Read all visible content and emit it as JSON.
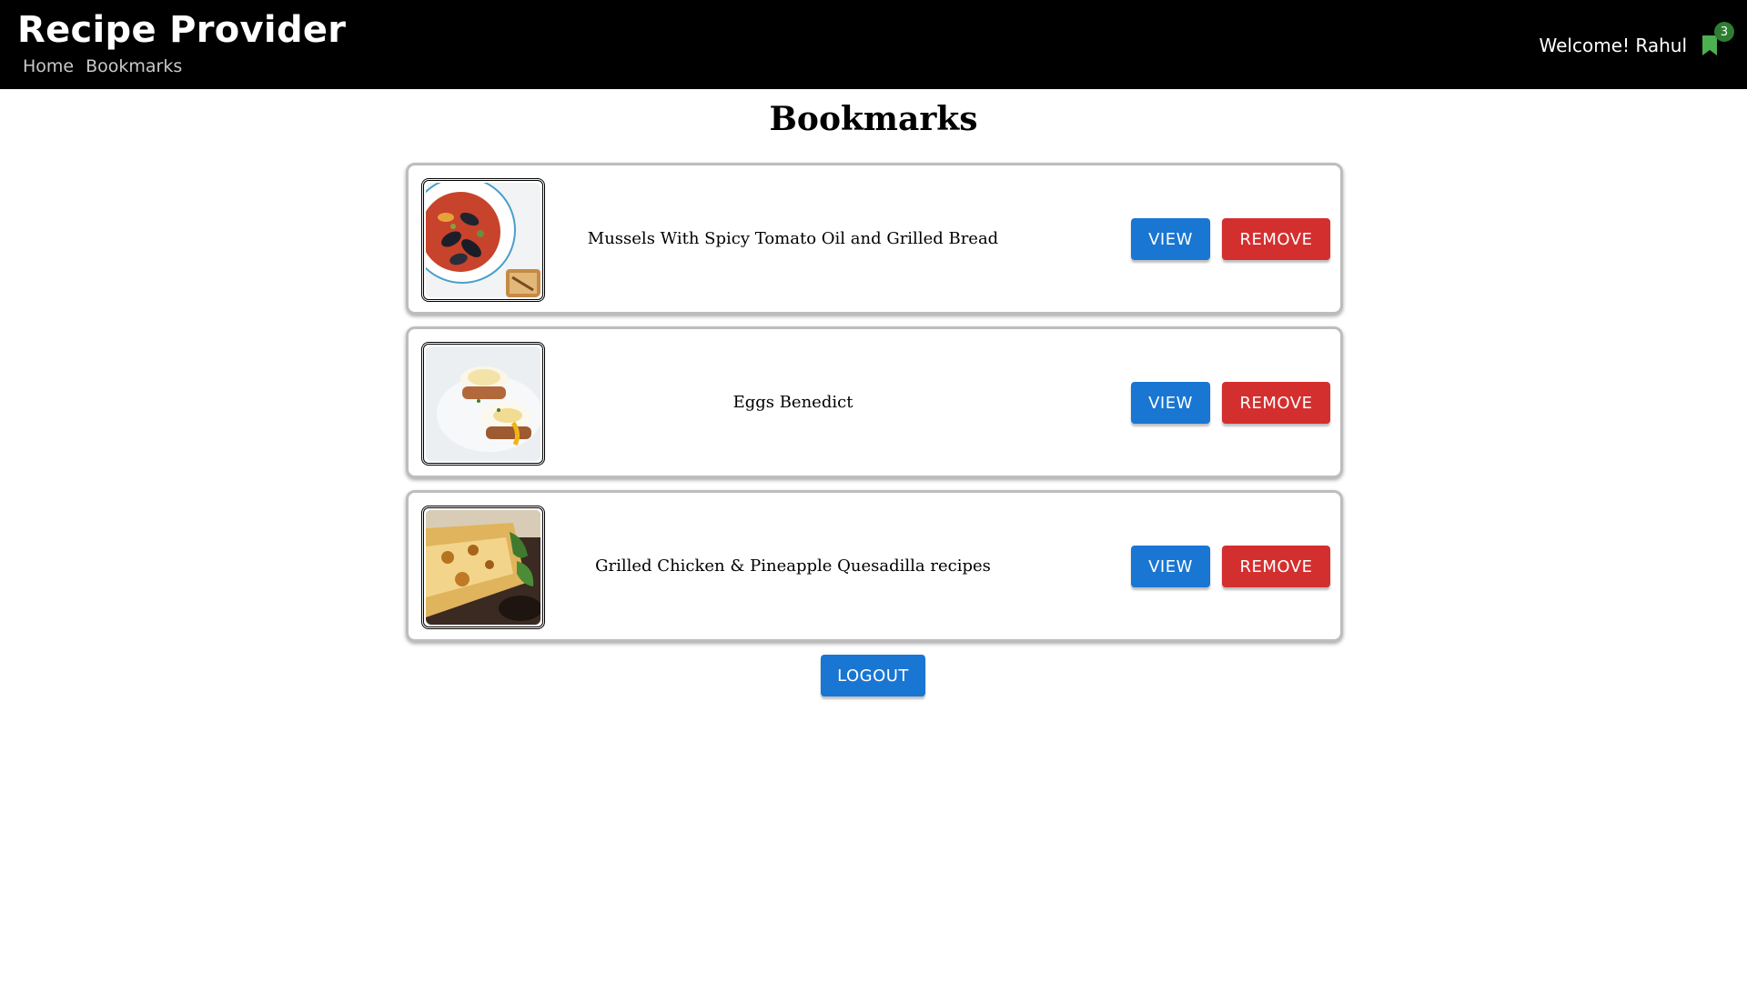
{
  "header": {
    "brand": "Recipe Provider",
    "nav": [
      "Home",
      "Bookmarks"
    ],
    "welcome": "Welcome! Rahul",
    "bookmark_count": "3",
    "bookmark_icon": "bookmark-icon",
    "badge_color": "#2e7d32",
    "bookmark_icon_color": "#4caf50"
  },
  "page": {
    "title": "Bookmarks"
  },
  "bookmarks": [
    {
      "title": "Mussels With Spicy Tomato Oil and Grilled Bread",
      "view_label": "VIEW",
      "remove_label": "REMOVE"
    },
    {
      "title": "Eggs Benedict",
      "view_label": "VIEW",
      "remove_label": "REMOVE"
    },
    {
      "title": "Grilled Chicken & Pineapple Quesadilla recipes",
      "view_label": "VIEW",
      "remove_label": "REMOVE"
    }
  ],
  "actions": {
    "logout_label": "LOGOUT"
  },
  "colors": {
    "primary": "#1976d2",
    "danger": "#d32f2f",
    "navbar": "#000000"
  }
}
